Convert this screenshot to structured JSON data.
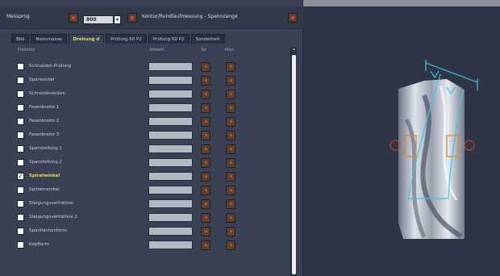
{
  "header": {
    "title": "Messprog",
    "select_value": "800",
    "subtitle": "Kontur/Rundlaufmessung - Spannzange"
  },
  "tabs": [
    {
      "label": "Bild"
    },
    {
      "label": "Nennmasse"
    },
    {
      "label": "Drehung d"
    },
    {
      "label": "Prüfung 60 P2"
    },
    {
      "label": "Prüfung 60 P2"
    },
    {
      "label": "Sonderheit"
    }
  ],
  "active_tab_index": 2,
  "columns": {
    "name": "Funktion",
    "value": "Istwert",
    "col3": "Ist",
    "col4": "Plan"
  },
  "rows": [
    {
      "label": "Schneiden-Prüfung",
      "checked": false
    },
    {
      "label": "Spanwinkel",
      "checked": false
    },
    {
      "label": "Schneidenecken",
      "checked": false
    },
    {
      "label": "Fasenbreite 1",
      "checked": false
    },
    {
      "label": "Fasenbreite 2",
      "checked": false
    },
    {
      "label": "Fasenbreite 3",
      "checked": false
    },
    {
      "label": "Spanstellung 1",
      "checked": false
    },
    {
      "label": "Spanstellung 2",
      "checked": false
    },
    {
      "label": "Spiralwinkel",
      "checked": true
    },
    {
      "label": "Spitzenwinkel",
      "checked": false
    },
    {
      "label": "Steigungsverhältnis",
      "checked": false
    },
    {
      "label": "Steigungsverhältnis 2",
      "checked": false
    },
    {
      "label": "Spanflächenform",
      "checked": false
    },
    {
      "label": "Kopfform",
      "checked": false
    }
  ],
  "colors": {
    "background": "#2e3547",
    "panel": "#3a4154",
    "accent_yellow": "#e6df4a",
    "cyan_overlay": "#3fc6e6",
    "orange_marker": "#d58a2a",
    "button_red": "#d8432a"
  },
  "icons": {
    "header_button": "record-icon",
    "row_button": "record-icon",
    "select_arrow": "chevron-down-icon",
    "scroll_arrow": "chevron-up-icon"
  }
}
